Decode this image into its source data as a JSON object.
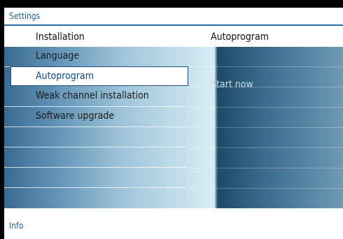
{
  "header": {
    "title": "Settings"
  },
  "columns": {
    "left_title": "Installation",
    "right_title": "Autoprogram"
  },
  "menu": {
    "items": [
      {
        "label": "Language",
        "selected": false
      },
      {
        "label": "Autoprogram",
        "selected": true
      },
      {
        "label": "Weak channel installation",
        "selected": false
      },
      {
        "label": "Software upgrade",
        "selected": false
      },
      {
        "label": "",
        "selected": false
      },
      {
        "label": "",
        "selected": false
      },
      {
        "label": "",
        "selected": false
      }
    ]
  },
  "submenu": {
    "items": [
      {
        "label": "Start now"
      }
    ]
  },
  "footer": {
    "info_label": "Info"
  }
}
